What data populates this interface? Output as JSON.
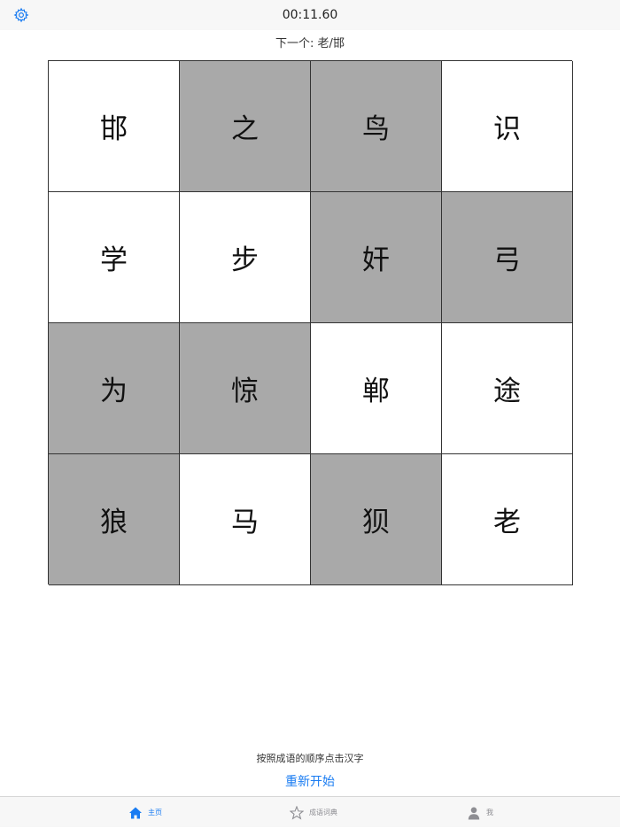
{
  "header": {
    "timer": "00:11.60",
    "settings_icon": "gear-icon"
  },
  "next": {
    "label": "下一个: 老/邯"
  },
  "grid": {
    "cells": [
      {
        "char": "邯",
        "shade": "white"
      },
      {
        "char": "之",
        "shade": "gray"
      },
      {
        "char": "鸟",
        "shade": "gray"
      },
      {
        "char": "识",
        "shade": "white"
      },
      {
        "char": "学",
        "shade": "white"
      },
      {
        "char": "步",
        "shade": "white"
      },
      {
        "char": "奸",
        "shade": "gray"
      },
      {
        "char": "弓",
        "shade": "gray"
      },
      {
        "char": "为",
        "shade": "gray"
      },
      {
        "char": "惊",
        "shade": "gray"
      },
      {
        "char": "郸",
        "shade": "white"
      },
      {
        "char": "途",
        "shade": "white"
      },
      {
        "char": "狼",
        "shade": "gray"
      },
      {
        "char": "马",
        "shade": "white"
      },
      {
        "char": "狈",
        "shade": "gray"
      },
      {
        "char": "老",
        "shade": "white"
      }
    ],
    "colors": {
      "gray": "#a9a9a9",
      "white": "#ffffff"
    }
  },
  "footer": {
    "instruction": "按照成语的顺序点击汉字",
    "restart_label": "重新开始"
  },
  "tabbar": {
    "items": [
      {
        "label": "主页",
        "icon": "home-icon",
        "active": true
      },
      {
        "label": "成语词典",
        "icon": "star-icon",
        "active": false
      },
      {
        "label": "我",
        "icon": "person-icon",
        "active": false
      }
    ]
  },
  "colors": {
    "accent": "#1a7cf2",
    "inactive": "#8e8e93"
  }
}
